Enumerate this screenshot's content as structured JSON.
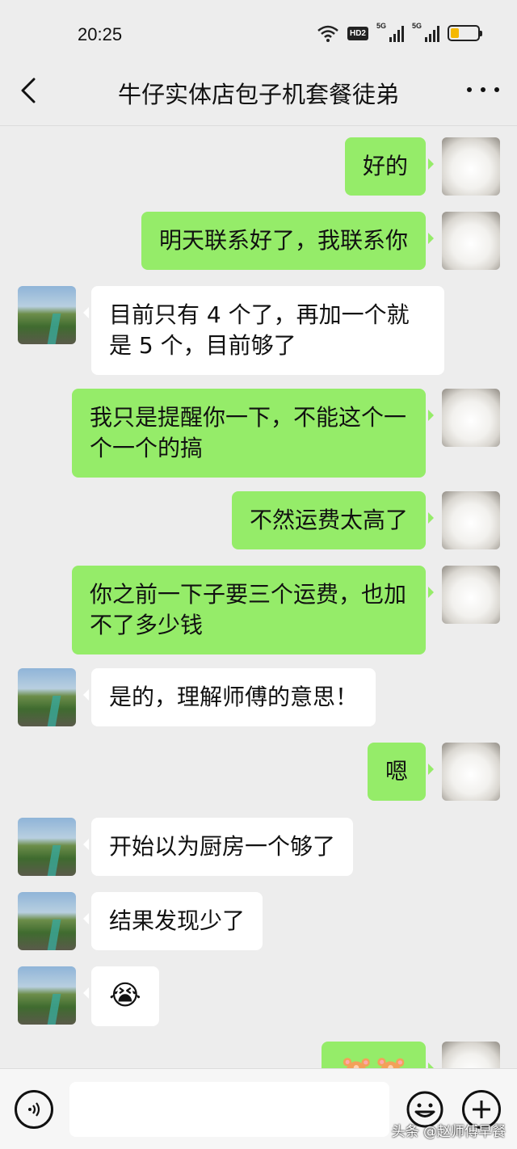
{
  "status": {
    "time": "20:25",
    "hd": "HD2",
    "net1": "5G",
    "net2": "5G",
    "battery_level": 0.3
  },
  "header": {
    "title": "牛仔实体店包子机套餐徒弟"
  },
  "messages": [
    {
      "side": "out",
      "text": "好的"
    },
    {
      "side": "out",
      "text": "明天联系好了，我联系你"
    },
    {
      "side": "in",
      "text": "目前只有 4 个了，再加一个就是 5 个，目前够了"
    },
    {
      "side": "out",
      "text": "我只是提醒你一下，不能这个一个一个的搞"
    },
    {
      "side": "out",
      "text": "不然运费太高了"
    },
    {
      "side": "out",
      "text": "你之前一下子要三个运费，也加不了多少钱"
    },
    {
      "side": "in",
      "text": "是的，理解师傅的意思！"
    },
    {
      "side": "out",
      "text": "嗯"
    },
    {
      "side": "in",
      "text": "开始以为厨房一个够了"
    },
    {
      "side": "in",
      "text": "结果发现少了"
    },
    {
      "side": "in",
      "text": "😭"
    },
    {
      "side": "out",
      "text": "🐹🐹"
    }
  ],
  "input": {
    "placeholder": ""
  },
  "watermark": "头条 @赵师傅早餐",
  "colors": {
    "outgoing_bubble": "#95ec69",
    "incoming_bubble": "#ffffff",
    "background": "#ededed"
  }
}
